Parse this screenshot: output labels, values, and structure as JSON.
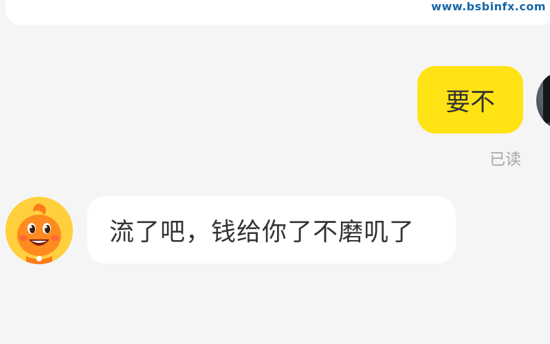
{
  "watermark": "www.bsbinfx.com",
  "messages": [
    {
      "direction": "out",
      "text": "要不",
      "status": "已读"
    },
    {
      "direction": "in",
      "text": "流了吧，钱给你了不磨叽了"
    }
  ],
  "colors": {
    "background": "#f5f5f5",
    "outgoing_bubble": "#ffe314",
    "incoming_bubble": "#ffffff",
    "text": "#333333",
    "status_text": "#a8a8a8",
    "watermark": "#1566a8"
  },
  "icons": {
    "peer_avatar": "orange-mascot-avatar",
    "self_avatar": "user-photo-avatar"
  }
}
